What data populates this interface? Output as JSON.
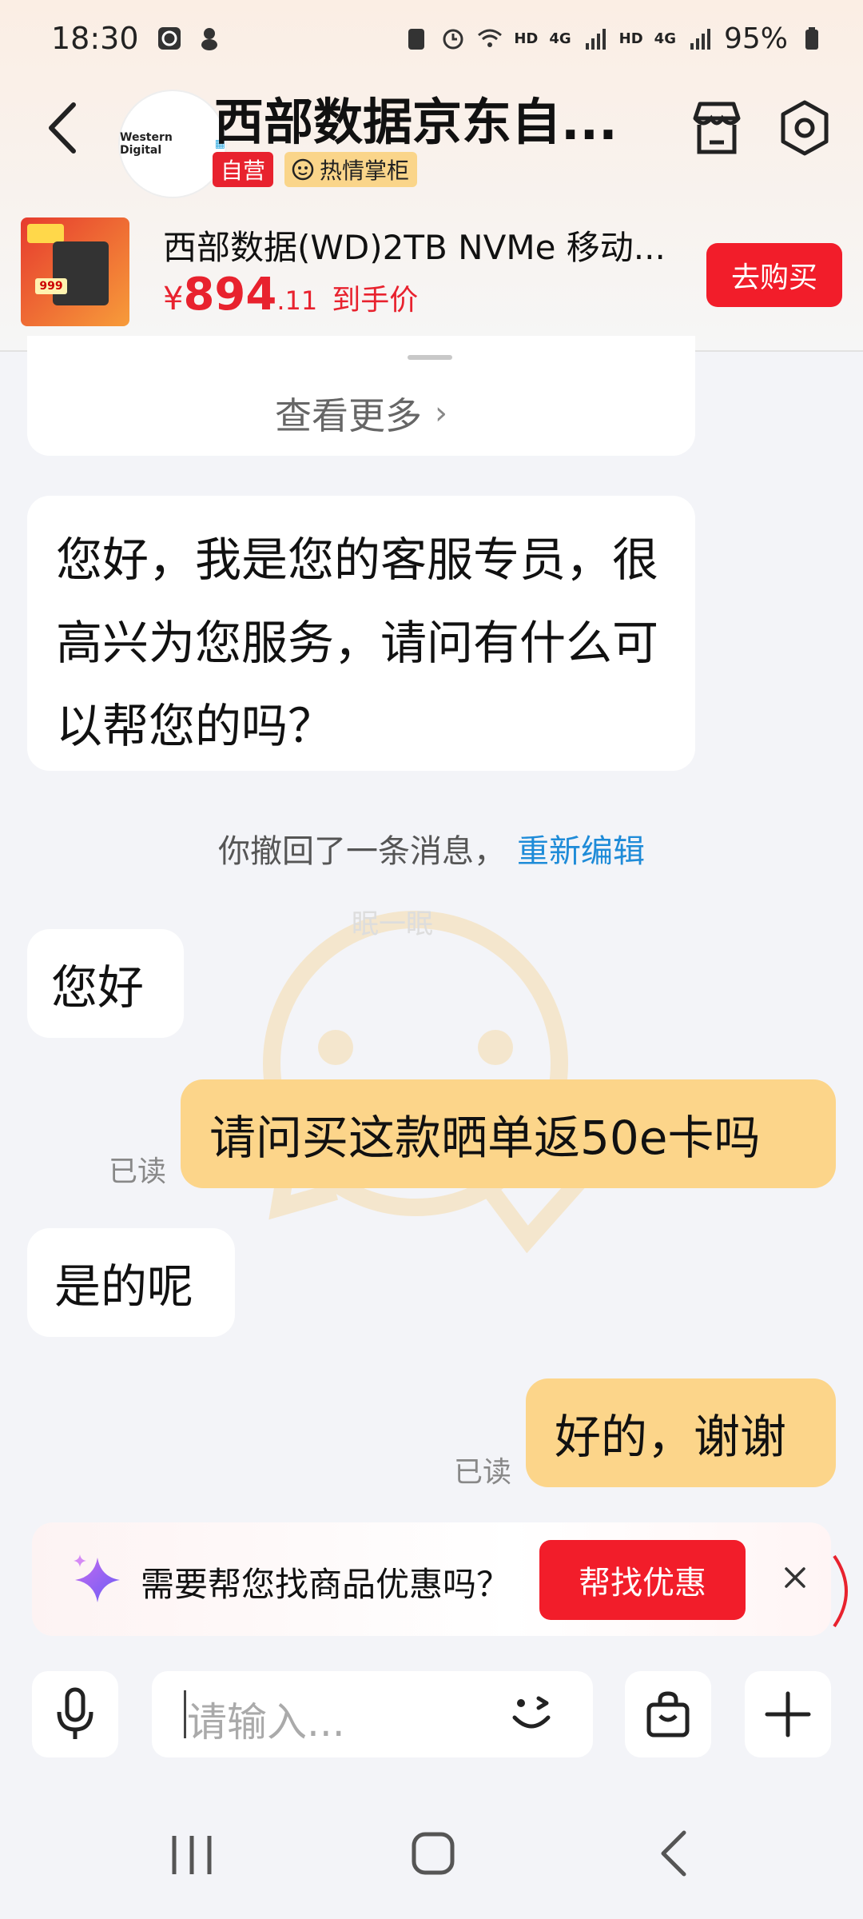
{
  "status_bar": {
    "time": "18:30",
    "network_1": "HD",
    "network_2": "HD",
    "signal_label_1": "4G",
    "signal_label_2": "4G",
    "battery": "95%"
  },
  "header": {
    "store_name": "西部数据京东自...",
    "store_logo_text": "Western Digital",
    "tag_self": "自营",
    "tag_hot": "热情掌柜"
  },
  "product": {
    "title": "西部数据(WD)2TB NVMe 移动...",
    "price_symbol": "¥",
    "price_int": "894",
    "price_dec": ".11",
    "price_label": "到手价",
    "buy_label": "去购买",
    "thumb_badge": "999"
  },
  "chat": {
    "see_more": "查看更多",
    "greeting": "您好，我是您的客服专员，很高兴为您服务，请问有什么可以帮您的吗？",
    "recall_text": "你撤回了一条消息，",
    "re_edit": "重新编辑",
    "watermark_text": "眠一眠",
    "messages": [
      {
        "side": "left",
        "text": "您好"
      },
      {
        "side": "right",
        "text": "请问买这款晒单返50e卡吗",
        "status": "已读"
      },
      {
        "side": "left",
        "text": "是的呢"
      },
      {
        "side": "right",
        "text": "好的，谢谢",
        "status": "已读"
      }
    ]
  },
  "promo": {
    "text": "需要帮您找商品优惠吗？",
    "button": "帮找优惠"
  },
  "input": {
    "placeholder": "请输入..."
  },
  "colors": {
    "accent_red": "#f21d2a",
    "self_bubble": "#fcd58a",
    "link_blue": "#1e8bd8"
  }
}
